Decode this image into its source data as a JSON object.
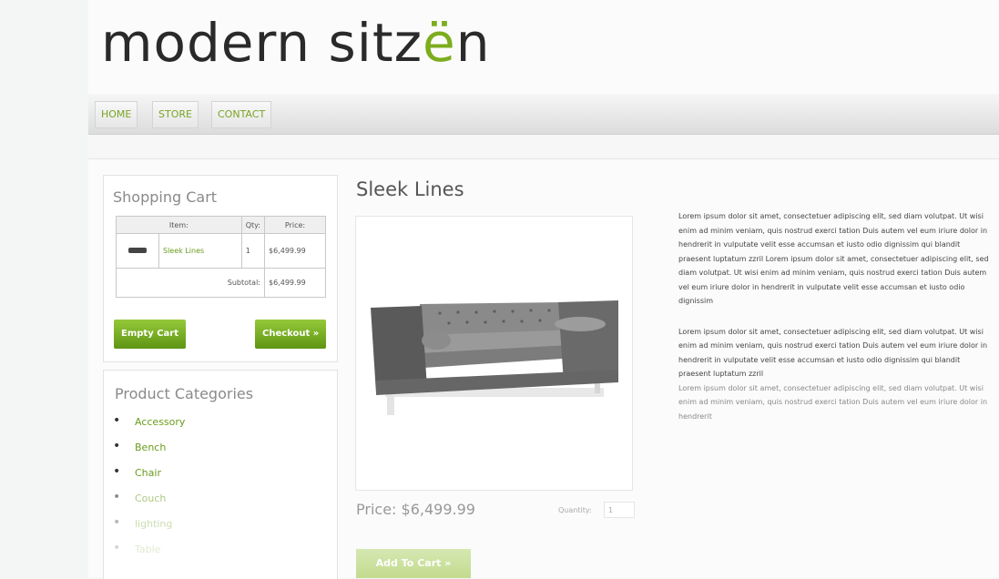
{
  "logo": {
    "text_part1": "modern sitz",
    "accent_char": "ë",
    "text_part2": "n"
  },
  "nav": {
    "items": [
      "HOME",
      "STORE",
      "CONTACT"
    ]
  },
  "cart": {
    "title": "Shopping Cart",
    "headers": [
      "Item:",
      "Qty:",
      "Price:"
    ],
    "row": {
      "name": "Sleek Lines",
      "qty": "1",
      "price": "$6,499.99"
    },
    "subtotal_label": "Subtotal:",
    "subtotal_value": "$6,499.99",
    "empty_button": "Empty Cart",
    "checkout_button": "Checkout »"
  },
  "categories": {
    "title": "Product Categories",
    "items": [
      "Accessory",
      "Bench",
      "Chair",
      "Couch",
      "lighting",
      "Table"
    ]
  },
  "product": {
    "title": "Sleek Lines",
    "price": "Price: $6,499.99",
    "quantity_label": "Quantity:",
    "quantity_value": "1",
    "add_button": "Add To Cart »",
    "description": [
      "Lorem ipsum dolor sit amet, consectetuer adipiscing elit, sed diam volutpat. Ut wisi enim ad minim veniam, quis nostrud exerci tation Duis autem vel eum iriure dolor in hendrerit in vulputate velit esse accumsan et iusto odio dignissim qui blandit praesent luptatum zzril Lorem ipsum dolor sit amet, consectetuer adipiscing elit, sed diam volutpat. Ut wisi enim ad minim veniam, quis nostrud exerci tation Duis autem vel eum iriure dolor in hendrerit in vulputate velit esse accumsan et iusto odio dignissim",
      "Lorem ipsum dolor sit amet, consectetuer adipiscing elit, sed diam volutpat. Ut wisi enim ad minim veniam, quis nostrud exerci tation Duis autem vel eum iriure dolor in hendrerit in vulputate velit esse accumsan et iusto odio dignissim qui blandit praesent luptatum zzril",
      "Lorem ipsum dolor sit amet, consectetuer adipiscing elit, sed diam volutpat. Ut wisi enim ad minim veniam, quis nostrud exerci tation Duis autem vel eum iriure dolor in hendrerit"
    ]
  },
  "colors": {
    "accent": "#7cad1e",
    "button_green": "#6fa61f"
  }
}
